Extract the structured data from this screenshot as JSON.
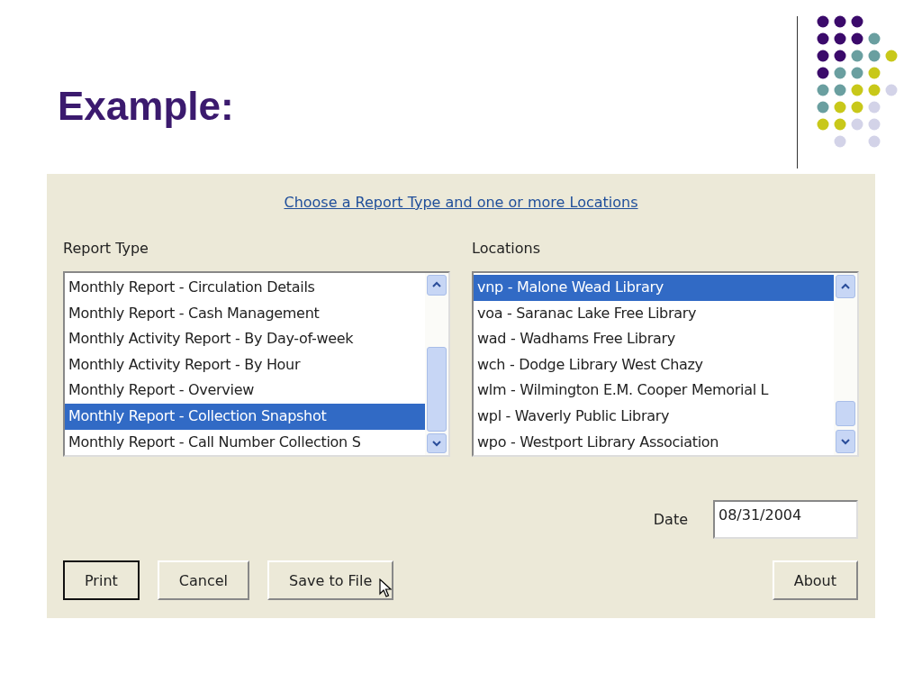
{
  "slide": {
    "title": "Example:"
  },
  "dialog": {
    "instruction_link": "Choose a Report Type and one or more Locations",
    "report_type": {
      "label": "Report Type",
      "items": [
        {
          "text": "Monthly Report - Circulation Details",
          "selected": false
        },
        {
          "text": "Monthly Report - Cash Management",
          "selected": false
        },
        {
          "text": "Monthly Activity Report - By Day-of-week",
          "selected": false
        },
        {
          "text": "Monthly Activity Report - By Hour",
          "selected": false
        },
        {
          "text": "Monthly Report - Overview",
          "selected": false
        },
        {
          "text": "Monthly Report - Collection Snapshot",
          "selected": true
        },
        {
          "text": "Monthly Report - Call Number Collection S",
          "selected": false
        }
      ]
    },
    "locations": {
      "label": "Locations",
      "items": [
        {
          "text": "vnp -  Malone Wead Library",
          "selected": true
        },
        {
          "text": "voa -  Saranac Lake Free Library",
          "selected": false
        },
        {
          "text": "wad -  Wadhams Free Library",
          "selected": false
        },
        {
          "text": "wch -  Dodge Library West Chazy",
          "selected": false
        },
        {
          "text": "wlm -  Wilmington E.M. Cooper Memorial L",
          "selected": false
        },
        {
          "text": "wpl -  Waverly Public Library",
          "selected": false
        },
        {
          "text": "wpo -  Westport Library Association",
          "selected": false
        }
      ]
    },
    "date": {
      "label": "Date",
      "value": "08/31/2004"
    },
    "buttons_left": [
      {
        "label": "Print",
        "default": true
      },
      {
        "label": "Cancel",
        "default": false
      },
      {
        "label": "Save to File",
        "default": false
      }
    ],
    "buttons_right": [
      {
        "label": "About",
        "default": false
      }
    ]
  }
}
